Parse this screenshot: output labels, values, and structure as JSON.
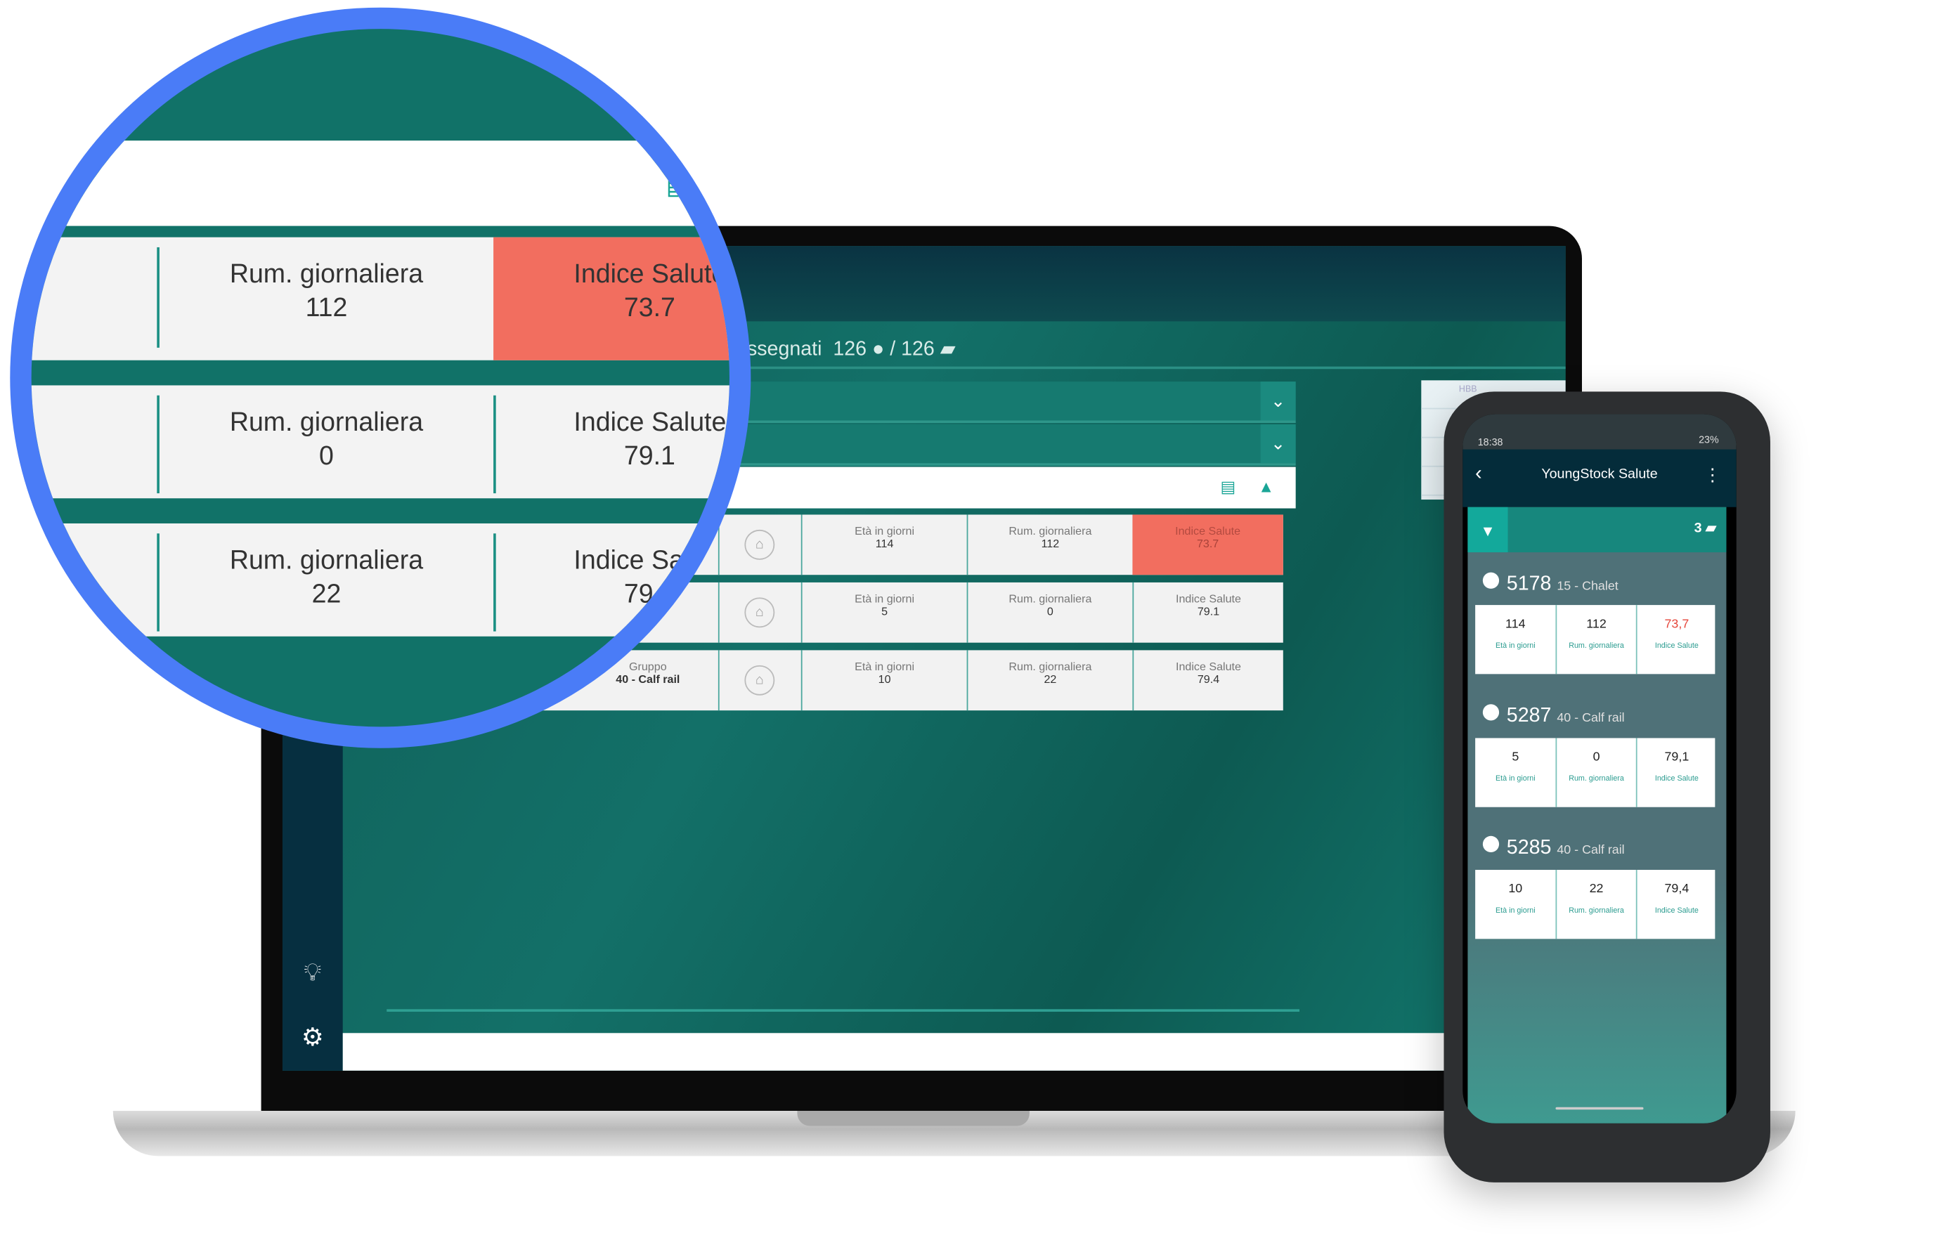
{
  "desktop": {
    "assigned_text": "ssegnati",
    "assigned_count_a": "126",
    "assigned_count_b": "126",
    "right_panel_label": "HBB",
    "columns": {
      "group": "Gruppo",
      "age": "Età in giorni",
      "rum": "Rum. giornaliera",
      "health": "Indice Salute"
    },
    "rows": [
      {
        "group": "",
        "age": "114",
        "rum": "112",
        "health": "73.7",
        "alert": true
      },
      {
        "group": "",
        "age": "5",
        "rum": "0",
        "health": "79.1",
        "alert": false
      },
      {
        "group": "40 - Calf rail",
        "age": "10",
        "rum": "22",
        "health": "79.4",
        "alert": false
      }
    ]
  },
  "mobile": {
    "status_time": "18:38",
    "battery": "23%",
    "title": "YoungStock Salute",
    "count": "3",
    "labels": {
      "age": "Età in giorni",
      "rum": "Rum. giornaliera",
      "health": "Indice Salute"
    },
    "animals": [
      {
        "id": "5178",
        "group": "15 - Chalet",
        "age": "114",
        "rum": "112",
        "health": "73,7",
        "alert": true
      },
      {
        "id": "5287",
        "group": "40 - Calf rail",
        "age": "5",
        "rum": "0",
        "health": "79,1",
        "alert": false
      },
      {
        "id": "5285",
        "group": "40 - Calf rail",
        "age": "10",
        "rum": "22",
        "health": "79,4",
        "alert": false
      }
    ]
  },
  "colors": {
    "teal": "#117268",
    "alert": "#f26e5f",
    "magnifier_ring": "#4a7cf7",
    "navy": "#042c3a"
  }
}
